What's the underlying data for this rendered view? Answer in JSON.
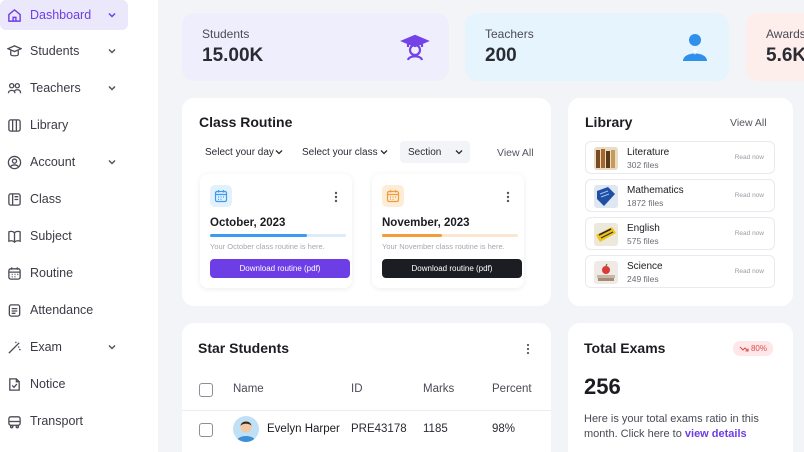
{
  "sidebar": {
    "items": [
      {
        "label": "Dashboard",
        "icon": "home-icon",
        "active": true,
        "chevron": true
      },
      {
        "label": "Students",
        "icon": "students-icon",
        "chevron": true
      },
      {
        "label": "Teachers",
        "icon": "teachers-icon",
        "chevron": true
      },
      {
        "label": "Library",
        "icon": "library-icon"
      },
      {
        "label": "Account",
        "icon": "account-icon",
        "chevron": true
      },
      {
        "label": "Class",
        "icon": "class-icon"
      },
      {
        "label": "Subject",
        "icon": "subject-icon"
      },
      {
        "label": "Routine",
        "icon": "routine-icon"
      },
      {
        "label": "Attendance",
        "icon": "attendance-icon"
      },
      {
        "label": "Exam",
        "icon": "exam-icon",
        "chevron": true
      },
      {
        "label": "Notice",
        "icon": "notice-icon"
      },
      {
        "label": "Transport",
        "icon": "transport-icon"
      }
    ]
  },
  "stats": {
    "students": {
      "label": "Students",
      "value": "15.00K"
    },
    "teachers": {
      "label": "Teachers",
      "value": "200"
    },
    "awards": {
      "label": "Awards",
      "value": "5.6K"
    }
  },
  "class_routine": {
    "title": "Class Routine",
    "filters": {
      "day": "Select your day",
      "class": "Select your class",
      "section": "Section"
    },
    "view_all": "View All",
    "cards": [
      {
        "month": "October, 2023",
        "desc": "Your October class routine is here.",
        "button": "Download routine (pdf)",
        "progress": 0.71
      },
      {
        "month": "November, 2023",
        "desc": "Your November class routine is here.",
        "button": "Download routine (pdf)",
        "progress": 0.44
      }
    ]
  },
  "library": {
    "title": "Library",
    "view_all": "View All",
    "items": [
      {
        "name": "Literature",
        "files": "302 files",
        "action": "Read now"
      },
      {
        "name": "Mathematics",
        "files": "1872 files",
        "action": "Read now"
      },
      {
        "name": "English",
        "files": "575 files",
        "action": "Read now"
      },
      {
        "name": "Science",
        "files": "249 files",
        "action": "Read now"
      }
    ]
  },
  "star_students": {
    "title": "Star Students",
    "columns": [
      "Name",
      "ID",
      "Marks",
      "Percent"
    ],
    "rows": [
      {
        "name": "Evelyn Harper",
        "id": "PRE43178",
        "marks": "1185",
        "percent": "98%"
      }
    ]
  },
  "total_exams": {
    "title": "Total Exams",
    "badge": "80%",
    "value": "256",
    "desc": "Here is your total exams ratio in this month. Click here to",
    "link": "view details"
  },
  "colors": {
    "accent": "#6d3ee6",
    "blue": "#3a9bf5",
    "orange": "#f39c3a"
  }
}
